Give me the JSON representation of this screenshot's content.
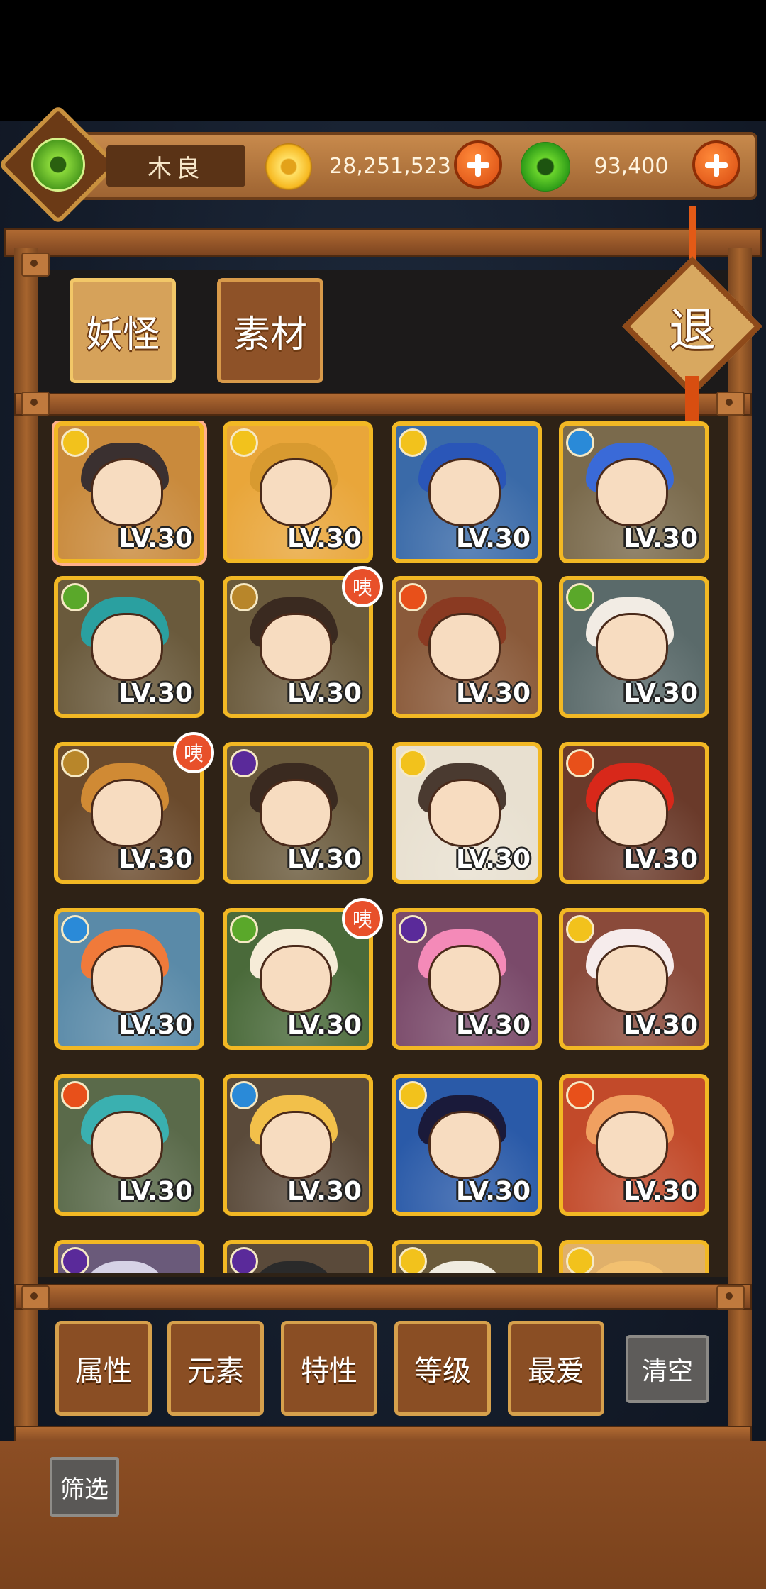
{
  "header": {
    "player_name": "木良",
    "coins": "28,251,523",
    "jade": "93,400"
  },
  "tabs": [
    {
      "label": "妖怪",
      "active": true
    },
    {
      "label": "素材",
      "active": false
    }
  ],
  "exit_label": "退",
  "badge_text": "咦",
  "level_text": "LV.30",
  "cards": [
    {
      "element": "light",
      "level": "LV.30",
      "new": false,
      "bg": "#c98a3c",
      "hair": "#3a3030",
      "outline": "#ffb08a"
    },
    {
      "element": "light",
      "level": "LV.30",
      "new": false,
      "bg": "#e9a63a",
      "hair": "#d89a30"
    },
    {
      "element": "light",
      "level": "LV.30",
      "new": false,
      "bg": "#3a6aa8",
      "hair": "#2a56b8"
    },
    {
      "element": "water",
      "level": "LV.30",
      "new": false,
      "bg": "#7a6a4c",
      "hair": "#3a6ad8"
    },
    {
      "element": "wood",
      "level": "LV.30",
      "new": false,
      "bg": "#6a5a3c",
      "hair": "#2aa0a0"
    },
    {
      "element": "earth",
      "level": "LV.30",
      "new": true,
      "bg": "#6a5a3c",
      "hair": "#3a2a20"
    },
    {
      "element": "fire",
      "level": "LV.30",
      "new": false,
      "bg": "#8a5a3a",
      "hair": "#8a3a22"
    },
    {
      "element": "wood",
      "level": "LV.30",
      "new": false,
      "bg": "#5a6a6a",
      "hair": "#f2ece4"
    },
    {
      "element": "earth",
      "level": "LV.30",
      "new": true,
      "bg": "#6a4a2c",
      "hair": "#d08a34"
    },
    {
      "element": "dark",
      "level": "LV.30",
      "new": false,
      "bg": "#6a5a3c",
      "hair": "#3a2a20"
    },
    {
      "element": "light",
      "level": "LV.30",
      "new": false,
      "bg": "#e8e0d0",
      "hair": "#4a3a30"
    },
    {
      "element": "fire",
      "level": "LV.30",
      "new": false,
      "bg": "#6a3a2a",
      "hair": "#d8281a"
    },
    {
      "element": "water",
      "level": "LV.30",
      "new": false,
      "bg": "#5a8aa8",
      "hair": "#f07a3a"
    },
    {
      "element": "wood",
      "level": "LV.30",
      "new": true,
      "bg": "#4a6a3a",
      "hair": "#f6ecd8"
    },
    {
      "element": "dark",
      "level": "LV.30",
      "new": false,
      "bg": "#7a4a6a",
      "hair": "#f48ab8"
    },
    {
      "element": "light",
      "level": "LV.30",
      "new": false,
      "bg": "#8a4a3a",
      "hair": "#f6ecec"
    },
    {
      "element": "fire",
      "level": "LV.30",
      "new": false,
      "bg": "#5a6a4a",
      "hair": "#3ab0b0"
    },
    {
      "element": "water",
      "level": "LV.30",
      "new": false,
      "bg": "#5a4a3a",
      "hair": "#f2c04a"
    },
    {
      "element": "light",
      "level": "LV.30",
      "new": false,
      "bg": "#2a5aa8",
      "hair": "#1a1a3a"
    },
    {
      "element": "fire",
      "level": "LV.30",
      "new": false,
      "bg": "#c24a2a",
      "hair": "#f0a060"
    },
    {
      "element": "dark",
      "level": "",
      "new": false,
      "bg": "#6a5a7a",
      "hair": "#d6d2e6"
    },
    {
      "element": "dark",
      "level": "",
      "new": false,
      "bg": "#5a4a3a",
      "hair": "#2a2a2a"
    },
    {
      "element": "light",
      "level": "",
      "new": false,
      "bg": "#6a5a3a",
      "hair": "#f0ece0"
    },
    {
      "element": "light",
      "level": "",
      "new": false,
      "bg": "#e0b06a",
      "hair": "#f2c070"
    }
  ],
  "filters": [
    "属性",
    "元素",
    "特性",
    "等级",
    "最爱"
  ],
  "clear_label": "清空",
  "filter_label": "筛选",
  "element_colors": {
    "light": "#f2c21c",
    "water": "#2a8ad8",
    "wood": "#5aa82a",
    "earth": "#b8862a",
    "fire": "#e8501a",
    "dark": "#5a2a9a"
  }
}
